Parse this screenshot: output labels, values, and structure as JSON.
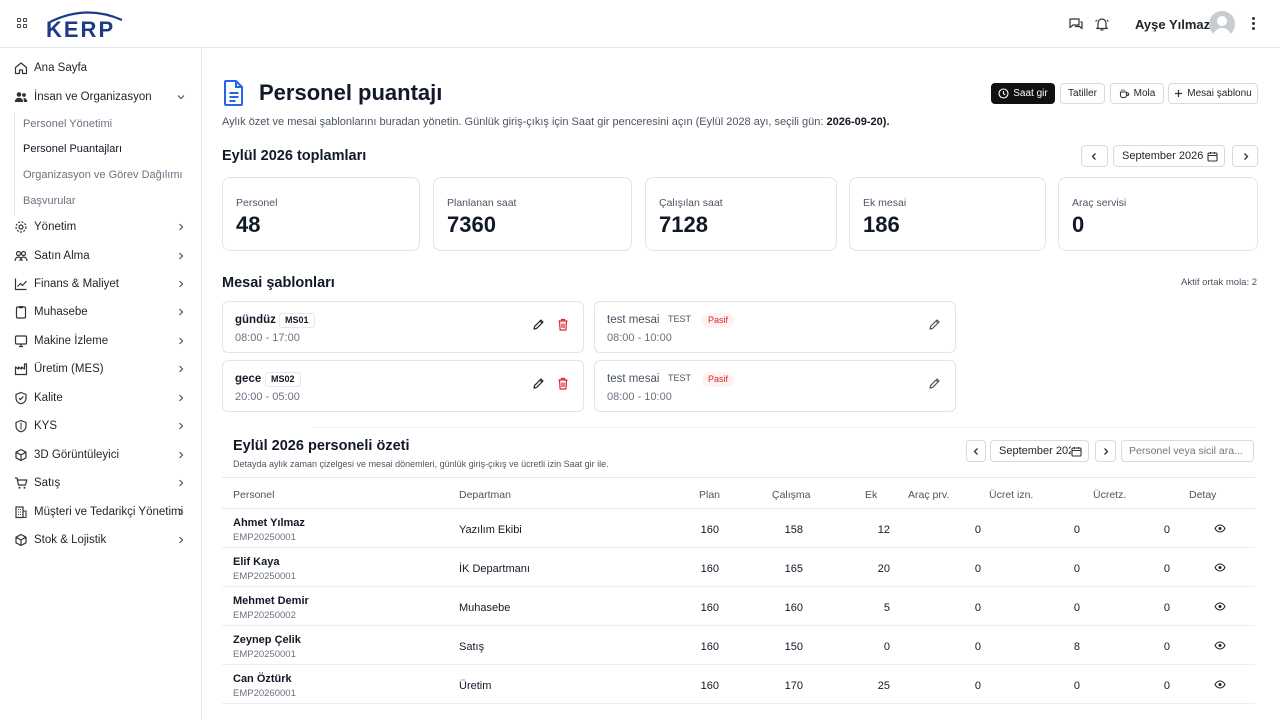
{
  "header": {
    "logo_text": "KERP",
    "user_name": "Ayşe Yılmaz"
  },
  "sidebar": {
    "items": [
      {
        "label": "Ana Sayfa",
        "icon": "home-icon"
      },
      {
        "label": "İnsan ve Organizasyon",
        "icon": "people-icon",
        "expanded": true
      },
      {
        "label": "Yönetim",
        "icon": "gear-icon"
      },
      {
        "label": "Satın Alma",
        "icon": "handshake-icon"
      },
      {
        "label": "Finans & Maliyet",
        "icon": "chart-line-icon"
      },
      {
        "label": "Muhasebe",
        "icon": "clipboard-icon"
      },
      {
        "label": "Makine İzleme",
        "icon": "monitor-icon"
      },
      {
        "label": "Üretim (MES)",
        "icon": "factory-icon"
      },
      {
        "label": "Kalite",
        "icon": "shield-check-icon"
      },
      {
        "label": "KYS",
        "icon": "shield-icon"
      },
      {
        "label": "3D Görüntüleyici",
        "icon": "cube-icon"
      },
      {
        "label": "Satış",
        "icon": "cart-icon"
      },
      {
        "label": "Müşteri ve Tedarikçi Yönetimi",
        "icon": "building-icon"
      },
      {
        "label": "Stok & Lojistik",
        "icon": "box-icon"
      }
    ],
    "sub_items": [
      {
        "label": "Personel Yönetimi",
        "active": false
      },
      {
        "label": "Personel Puantajları",
        "active": true
      },
      {
        "label": "Organizasyon ve Görev Dağılımı",
        "active": false
      },
      {
        "label": "Başvurular",
        "active": false
      }
    ]
  },
  "page": {
    "title": "Personel puantajı",
    "description": "Aylık özet ve mesai şablonlarını buradan yönetin. Günlük giriş-çıkış için Saat gir penceresini açın (Eylül 2028 ayı, seçili gün:",
    "selected_day": "2026-09-20",
    "description_end": ")."
  },
  "actions": {
    "saat_gir": "Saat gir",
    "tatiller": "Tatiller",
    "mola": "Mola",
    "mesai_sablonu": "Mesai şablonu"
  },
  "totals": {
    "title": "Eylül 2026 toplamları",
    "month_value": "September 2026",
    "cards": [
      {
        "label": "Personel",
        "value": "48"
      },
      {
        "label": "Planlanan saat",
        "value": "7360"
      },
      {
        "label": "Çalışılan saat",
        "value": "7128"
      },
      {
        "label": "Ek mesai",
        "value": "186"
      },
      {
        "label": "Araç servisi",
        "value": "0"
      }
    ]
  },
  "templates": {
    "title": "Mesai şablonları",
    "active_break_text": "Aktif ortak mola: 2",
    "items": [
      {
        "name": "gündüz",
        "code": "MS01",
        "time": "08:00 - 17:00",
        "status": "",
        "active": true
      },
      {
        "name": "test mesai",
        "code": "TEST",
        "time": "08:00 - 10:00",
        "status": "Pasif",
        "active": false
      },
      {
        "name": "gece",
        "code": "MS02",
        "time": "20:00 - 05:00",
        "status": "",
        "active": true
      },
      {
        "name": "test mesai",
        "code": "TEST",
        "time": "08:00 - 10:00",
        "status": "Pasif",
        "active": false
      }
    ]
  },
  "summary": {
    "title": "Eylül 2026 personeli özeti",
    "description": "Detayda aylık zaman çizelgesi ve mesai dönemleri, günlük giriş-çıkış ve ücretli izin Saat gir ile.",
    "month_value": "September 2026",
    "search_placeholder": "Personel veya sicil ara...",
    "columns": [
      "Personel",
      "Departman",
      "Plan",
      "Çalışma",
      "Ek",
      "Araç prv.",
      "Ücret izn.",
      "Ücretz.",
      "Detay"
    ],
    "rows": [
      {
        "name": "Ahmet Yılmaz",
        "code": "EMP20250001",
        "department": "Yazılım Ekibi",
        "plan": "160",
        "work": "158",
        "extra": "12",
        "vehicle": "0",
        "paid_leave": "0",
        "unpaid": "0"
      },
      {
        "name": "Elif Kaya",
        "code": "EMP20250001",
        "department": "İK Departmanı",
        "plan": "160",
        "work": "165",
        "extra": "20",
        "vehicle": "0",
        "paid_leave": "0",
        "unpaid": "0"
      },
      {
        "name": "Mehmet Demir",
        "code": "EMP20250002",
        "department": "Muhasebe",
        "plan": "160",
        "work": "160",
        "extra": "5",
        "vehicle": "0",
        "paid_leave": "0",
        "unpaid": "0"
      },
      {
        "name": "Zeynep Çelik",
        "code": "EMP20250001",
        "department": "Satış",
        "plan": "160",
        "work": "150",
        "extra": "0",
        "vehicle": "0",
        "paid_leave": "8",
        "unpaid": "0"
      },
      {
        "name": "Can Öztürk",
        "code": "EMP20260001",
        "department": "Üretim",
        "plan": "160",
        "work": "170",
        "extra": "25",
        "vehicle": "0",
        "paid_leave": "0",
        "unpaid": "0"
      }
    ]
  },
  "colors": {
    "accent": "#1e3a8a",
    "danger": "#dc2626",
    "primary_button": "#111111"
  }
}
